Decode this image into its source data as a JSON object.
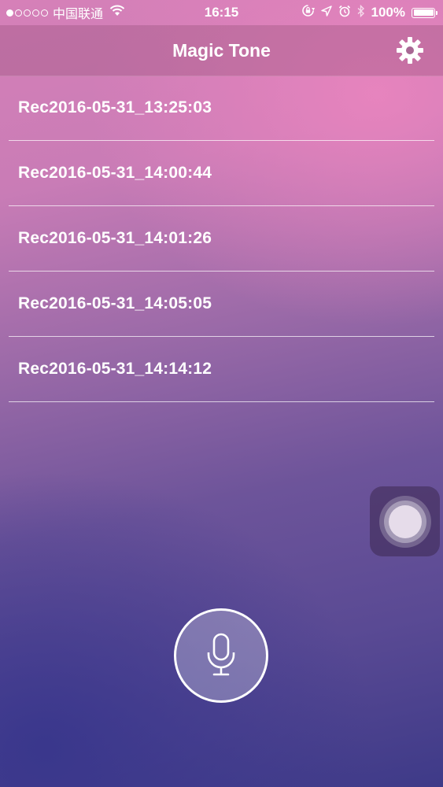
{
  "status_bar": {
    "carrier": "中国联通",
    "time": "16:15",
    "battery_percent": "100%",
    "battery_level": 1.0,
    "signal_bars_filled": 1,
    "signal_bars_total": 5,
    "icons": [
      "wifi-icon",
      "orientation-lock-icon",
      "location-icon",
      "alarm-icon",
      "bluetooth-icon",
      "battery-icon"
    ]
  },
  "nav": {
    "title": "Magic Tone",
    "settings_icon": "gear-icon"
  },
  "recordings": [
    "Rec2016-05-31_13:25:03",
    "Rec2016-05-31_14:00:44",
    "Rec2016-05-31_14:01:26",
    "Rec2016-05-31_14:05:05",
    "Rec2016-05-31_14:14:12"
  ],
  "record_button": {
    "icon": "microphone-icon"
  },
  "assistive_touch": {
    "icon": "assistive-touch-icon"
  },
  "colors": {
    "gradient_top": "#d680b8",
    "gradient_bottom": "#3e3a88",
    "text": "#ffffff"
  }
}
